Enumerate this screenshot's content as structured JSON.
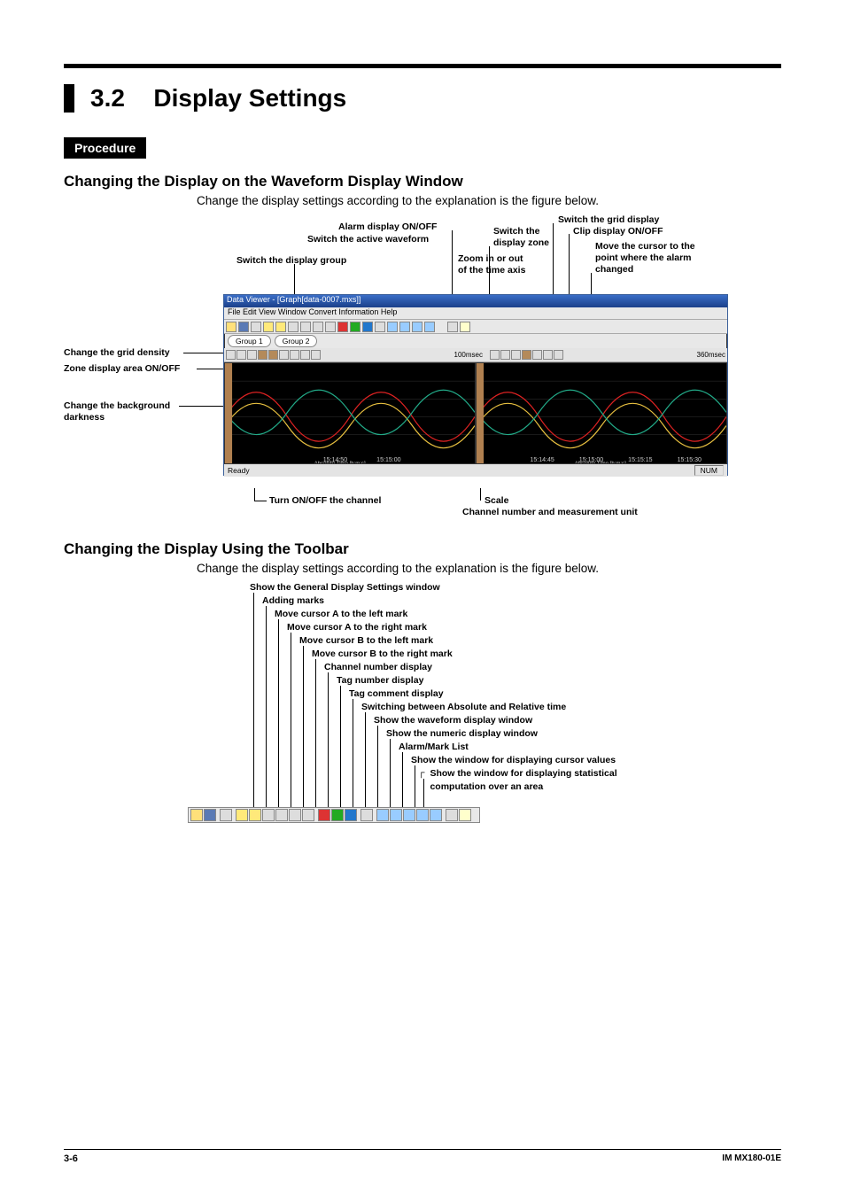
{
  "page": {
    "section_number": "3.2",
    "section_title": "Display Settings",
    "procedure_label": "Procedure",
    "footer_page": "3-6",
    "footer_code": "IM MX180-01E"
  },
  "sec1": {
    "heading": "Changing the Display on the Waveform Display Window",
    "explain": "Change the display settings according to the explanation is the figure below.",
    "callouts": {
      "alarm_onoff": "Alarm display ON/OFF",
      "switch_active_wave": "Switch the active waveform",
      "switch_display_group": "Switch the display group",
      "switch_the": "Switch the",
      "display_zone": "display zone",
      "switch_grid_display": "Switch the grid display",
      "clip_onoff": "Clip display ON/OFF",
      "zoom": "Zoom in or out",
      "zoom2": "of the time axis",
      "move_cursor_alarm1": "Move the cursor to the",
      "move_cursor_alarm2": "point where the alarm",
      "move_cursor_alarm3": "changed",
      "grid_density": "Change the grid density",
      "zone_onoff": "Zone display area ON/OFF",
      "bg_dark1": "Change the background",
      "bg_dark2": "darkness",
      "turn_onoff_channel": "Turn ON/OFF the channel",
      "scale": "Scale",
      "chnum_unit": "Channel number and measurement unit"
    },
    "app": {
      "title": "Data Viewer - [Graph[data-0007.mxs]]",
      "menubar": "File   Edit   View   Window   Convert   Information   Help",
      "tab1": "Group 1",
      "tab2": "Group 2",
      "status_ready": "Ready",
      "status_right": "NUM",
      "tscale1": "100msec",
      "tscale2": "360msec"
    }
  },
  "sec2": {
    "heading": "Changing the Display Using the Toolbar",
    "explain": "Change the display settings according to the explanation is the figure below.",
    "tree": {
      "l0": "Show the General Display Settings window",
      "l1": "Adding marks",
      "l2": "Move cursor A to the left mark",
      "l3": "Move cursor A to the right mark",
      "l4": "Move cursor B to the left mark",
      "l5": "Move cursor B to the right mark",
      "l6": "Channel number display",
      "l7": "Tag number display",
      "l8": "Tag comment display",
      "l9": "Switching between Absolute and Relative time",
      "l10": "Show the waveform display window",
      "l11": "Show the numeric display window",
      "l12": "Alarm/Mark List",
      "l13": "Show the window for displaying cursor values",
      "l14a": "Show the window for displaying statistical",
      "l14b": "computation over an area"
    }
  }
}
